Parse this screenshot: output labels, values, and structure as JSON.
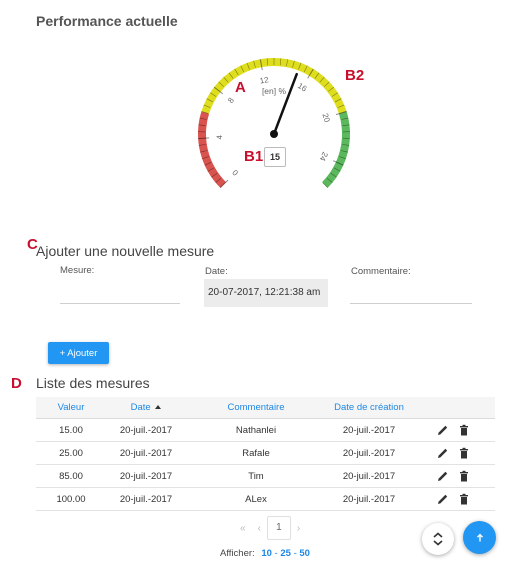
{
  "performance": {
    "title": "Performance actuelle",
    "gauge": {
      "unit_label": "[en] %",
      "value": 15,
      "value_display": "15",
      "min": 0,
      "max": 26,
      "ticks": [
        "0",
        "4",
        "8",
        "12",
        "16",
        "20",
        "24"
      ],
      "zones": [
        {
          "from": 0,
          "to": 6,
          "color": "#d9534f"
        },
        {
          "from": 6,
          "to": 20,
          "color": "#dede1f"
        },
        {
          "from": 20,
          "to": 26,
          "color": "#5cb85c"
        }
      ]
    }
  },
  "markers": {
    "a": "A",
    "b1": "B1",
    "b2": "B2",
    "c": "C",
    "d": "D"
  },
  "form": {
    "title": "Ajouter une nouvelle mesure",
    "mesure_label": "Mesure:",
    "date_label": "Date:",
    "date_value": "20-07-2017, 12:21:38 am",
    "commentaire_label": "Commentaire:",
    "add_button": "+ Ajouter"
  },
  "list": {
    "title": "Liste des mesures",
    "columns": {
      "valeur": "Valeur",
      "date": "Date",
      "commentaire": "Commentaire",
      "date_creation": "Date de création"
    },
    "rows": [
      {
        "valeur": "15.00",
        "date": "20-juil.-2017",
        "commentaire": "Nathanlei",
        "date_creation": "20-juil.-2017"
      },
      {
        "valeur": "25.00",
        "date": "20-juil.-2017",
        "commentaire": "Rafale",
        "date_creation": "20-juil.-2017"
      },
      {
        "valeur": "85.00",
        "date": "20-juil.-2017",
        "commentaire": "Tim",
        "date_creation": "20-juil.-2017"
      },
      {
        "valeur": "100.00",
        "date": "20-juil.-2017",
        "commentaire": "ALex",
        "date_creation": "20-juil.-2017"
      }
    ],
    "pagination": {
      "first": "«",
      "prev": "‹",
      "page": "1",
      "next": "›",
      "last": "»"
    },
    "afficher_label": "Afficher:",
    "page_sizes": [
      "10",
      "25",
      "50"
    ],
    "page_size_sep": "-"
  },
  "colors": {
    "accent": "#2196f3",
    "marker": "#c8102e"
  }
}
